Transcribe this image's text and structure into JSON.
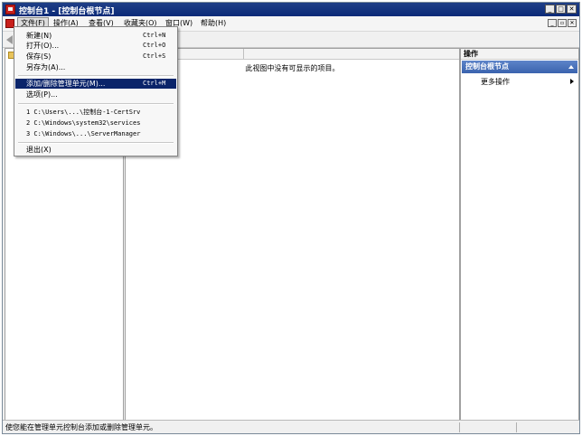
{
  "window": {
    "title": "控制台1 - [控制台根节点]"
  },
  "menubar": {
    "items": [
      "文件(F)",
      "操作(A)",
      "查看(V)",
      "收藏夹(O)",
      "窗口(W)",
      "帮助(H)"
    ]
  },
  "file_menu": {
    "items": [
      {
        "label": "新建(N)",
        "shortcut": "Ctrl+N"
      },
      {
        "label": "打开(O)...",
        "shortcut": "Ctrl+O"
      },
      {
        "label": "保存(S)",
        "shortcut": "Ctrl+S"
      },
      {
        "label": "另存为(A)...",
        "shortcut": ""
      },
      {
        "label": "添加/删除管理单元(M)...",
        "shortcut": "Ctrl+M",
        "highlighted": true
      },
      {
        "label": "选项(P)...",
        "shortcut": ""
      },
      {
        "label": "1 C:\\Users\\...\\控制台-1-CertSrv",
        "shortcut": ""
      },
      {
        "label": "2 C:\\Windows\\system32\\services",
        "shortcut": ""
      },
      {
        "label": "3 C:\\Windows\\...\\ServerManager",
        "shortcut": ""
      },
      {
        "label": "退出(X)",
        "shortcut": ""
      }
    ]
  },
  "center": {
    "empty_message": "此视图中没有可显示的项目。"
  },
  "actions_pane": {
    "header": "操作",
    "section": "控制台根节点",
    "more_actions": "更多操作"
  },
  "status": {
    "text": "使您能在管理单元控制台添加或删除管理单元。"
  },
  "colors": {
    "title_bar": "#0b2a78",
    "highlight": "#0a246a",
    "actions_section": "#3a63ae"
  }
}
